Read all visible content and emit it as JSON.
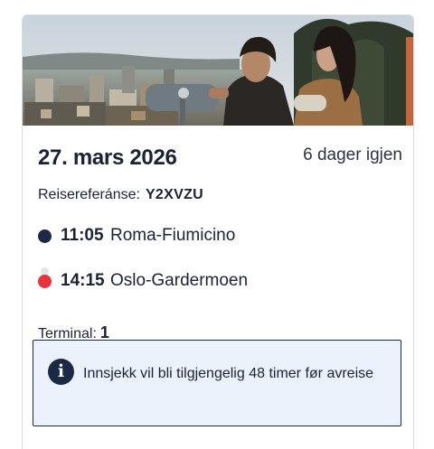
{
  "booking": {
    "date": "27. mars 2026",
    "countdown": "6 dager igjen",
    "reference_label": "Reisereferánse:",
    "reference_code": "Y2XVZU"
  },
  "itinerary": {
    "departure": {
      "time": "11:05",
      "place": "Roma-Fiumicino",
      "dot_color": "#1b2a47"
    },
    "arrival": {
      "time": "14:15",
      "place": "Oslo-Gardermoen",
      "dot_color": "#e8323c"
    }
  },
  "terminal": {
    "label": "Terminal:",
    "value": "1"
  },
  "notice": {
    "icon": "info-icon",
    "text": "Innsjekk vil bli tilgjengelig 48 timer før avreise"
  },
  "colors": {
    "primary": "#1a2a45",
    "accent_red": "#e8323c",
    "notice_bg": "#ebf2fb"
  }
}
